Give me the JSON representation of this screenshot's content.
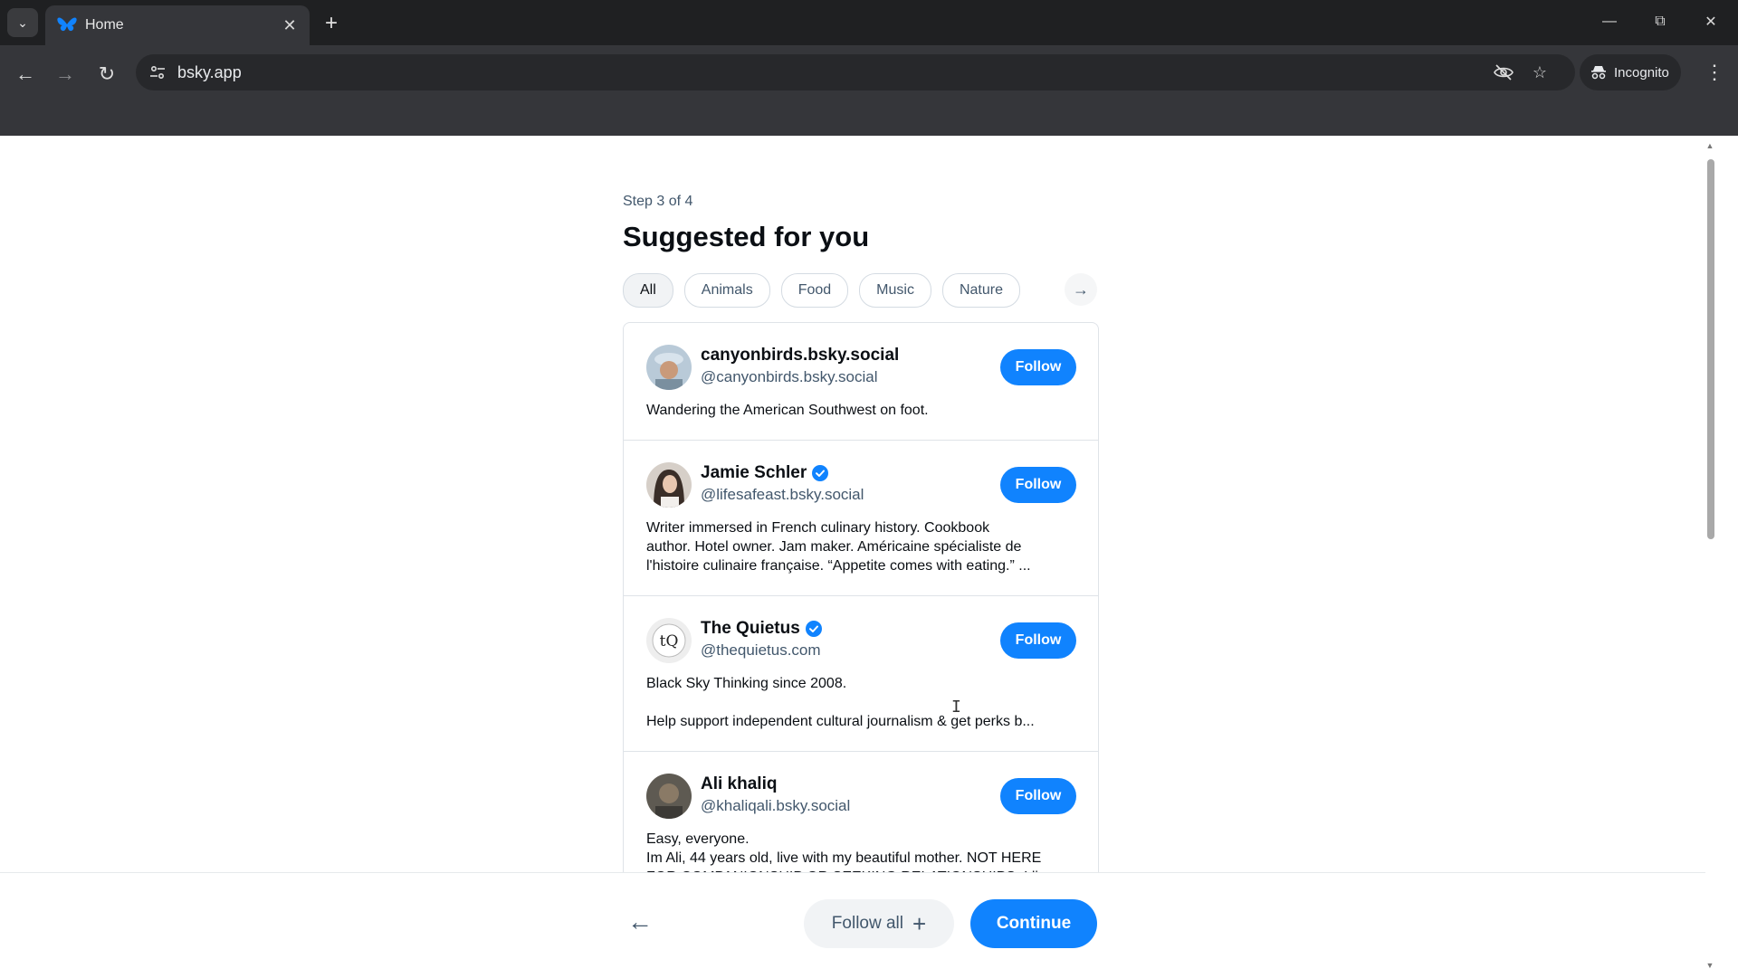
{
  "browser": {
    "tab_title": "Home",
    "url": "bsky.app",
    "incognito_label": "Incognito"
  },
  "onboarding": {
    "step": "Step 3 of 4",
    "title": "Suggested for you",
    "chips": [
      "All",
      "Animals",
      "Food",
      "Music",
      "Nature"
    ],
    "active_chip": "All"
  },
  "accounts": [
    {
      "name": "canyonbirds.bsky.social",
      "handle": "@canyonbirds.bsky.social",
      "verified": false,
      "bio": "Wandering the American Southwest on foot.",
      "follow_label": "Follow"
    },
    {
      "name": "Jamie Schler",
      "handle": "@lifesafeast.bsky.social",
      "verified": true,
      "bio": "Writer immersed in French culinary history. Cookbook\nauthor. Hotel owner. Jam maker. Américaine spécialiste de\nl'histoire culinaire française. “Appetite comes with eating.” ...",
      "follow_label": "Follow"
    },
    {
      "name": "The Quietus",
      "handle": "@thequietus.com",
      "verified": true,
      "bio": "Black Sky Thinking since 2008.\n\nHelp support independent cultural journalism & get perks b...",
      "follow_label": "Follow"
    },
    {
      "name": "Ali khaliq",
      "handle": "@khaliqali.bsky.social",
      "verified": false,
      "bio": "Easy, everyone.\nIm Ali, 44 years old, live with my beautiful mother. NOT HERE\nFOR COMPANIONSHIP OR SEEKING RELATIONSHIPS. I live...",
      "follow_label": "Follow"
    }
  ],
  "footer": {
    "follow_all_label": "Follow all",
    "continue_label": "Continue"
  },
  "colors": {
    "accent": "#1083fe",
    "muted_text": "#42576c"
  }
}
